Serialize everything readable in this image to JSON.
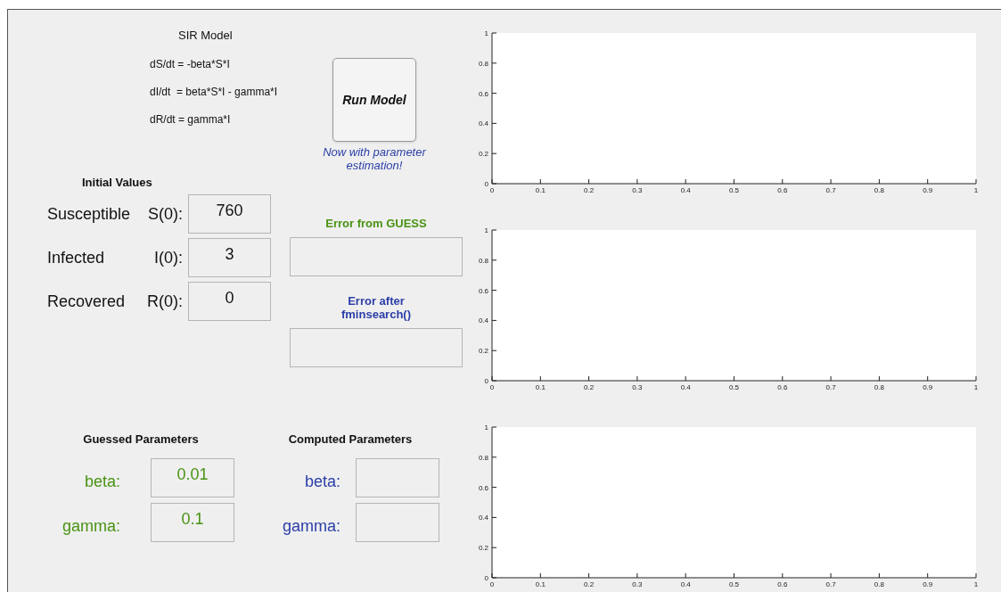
{
  "model": {
    "title": "SIR Model",
    "equations": [
      "dS/dt = -beta*S*I",
      "dI/dt  = beta*S*I - gamma*I",
      "dR/dt = gamma*I"
    ]
  },
  "run_button": {
    "label": "Run Model",
    "note": "Now with parameter estimation!"
  },
  "initial_values": {
    "heading": "Initial Values",
    "rows": [
      {
        "name": "Susceptible",
        "symbol": "S(0):",
        "value": "760"
      },
      {
        "name": "Infected",
        "symbol": "I(0):",
        "value": "3"
      },
      {
        "name": "Recovered",
        "symbol": "R(0):",
        "value": "0"
      }
    ]
  },
  "errors": [
    {
      "label": "Error from GUESS",
      "color": "#4a9314"
    },
    {
      "label": "Error after fminsearch()",
      "color": "#2b3ea8"
    }
  ],
  "parameter_groups": [
    {
      "heading": "Guessed Parameters",
      "color": "#4a9314",
      "params": [
        {
          "label": "beta:",
          "value": "0.01"
        },
        {
          "label": "gamma:",
          "value": "0.1"
        }
      ]
    },
    {
      "heading": "Computed Parameters",
      "color": "#2b3ea8",
      "params": [
        {
          "label": "beta:"
        },
        {
          "label": "gamma:"
        }
      ]
    }
  ],
  "plots": [
    {
      "chart_data": {
        "type": "line",
        "xlim": [
          0,
          1
        ],
        "ylim": [
          0,
          1
        ],
        "xticks": [
          0,
          0.1,
          0.2,
          0.3,
          0.4,
          0.5,
          0.6,
          0.7,
          0.8,
          0.9,
          1
        ],
        "yticks": [
          0,
          0.2,
          0.4,
          0.6,
          0.8,
          1
        ]
      }
    },
    {
      "chart_data": {
        "type": "line",
        "xlim": [
          0,
          1
        ],
        "ylim": [
          0,
          1
        ],
        "xticks": [
          0,
          0.1,
          0.2,
          0.3,
          0.4,
          0.5,
          0.6,
          0.7,
          0.8,
          0.9,
          1
        ],
        "yticks": [
          0,
          0.2,
          0.4,
          0.6,
          0.8,
          1
        ]
      }
    },
    {
      "chart_data": {
        "type": "line",
        "xlim": [
          0,
          1
        ],
        "ylim": [
          0,
          1
        ],
        "xticks": [
          0,
          0.1,
          0.2,
          0.3,
          0.4,
          0.5,
          0.6,
          0.7,
          0.8,
          0.9,
          1
        ],
        "yticks": [
          0,
          0.2,
          0.4,
          0.6,
          0.8,
          1
        ]
      }
    }
  ]
}
